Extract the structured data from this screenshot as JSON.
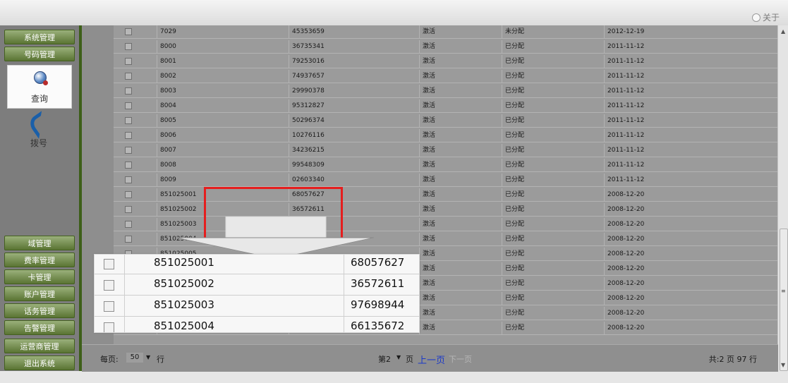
{
  "top": {
    "about_label": "关于"
  },
  "sidebar": {
    "top_items": [
      "系统管理",
      "号码管理"
    ],
    "panels": [
      {
        "label": "查询",
        "icon": "query-icon"
      },
      {
        "label": "拨号",
        "icon": "phone-icon"
      }
    ],
    "bottom_items": [
      "域管理",
      "费率管理",
      "卡管理",
      "账户管理",
      "话务管理",
      "告警管理",
      "运营商管理",
      "退出系统"
    ]
  },
  "grid": {
    "rows": [
      [
        "7029",
        "45353659",
        "激活",
        "未分配",
        "2012-12-19"
      ],
      [
        "8000",
        "36735341",
        "激活",
        "已分配",
        "2011-11-12"
      ],
      [
        "8001",
        "79253016",
        "激活",
        "已分配",
        "2011-11-12"
      ],
      [
        "8002",
        "74937657",
        "激活",
        "已分配",
        "2011-11-12"
      ],
      [
        "8003",
        "29990378",
        "激活",
        "已分配",
        "2011-11-12"
      ],
      [
        "8004",
        "95312827",
        "激活",
        "已分配",
        "2011-11-12"
      ],
      [
        "8005",
        "50296374",
        "激活",
        "已分配",
        "2011-11-12"
      ],
      [
        "8006",
        "10276116",
        "激活",
        "已分配",
        "2011-11-12"
      ],
      [
        "8007",
        "34236215",
        "激活",
        "已分配",
        "2011-11-12"
      ],
      [
        "8008",
        "99548309",
        "激活",
        "已分配",
        "2011-11-12"
      ],
      [
        "8009",
        "02603340",
        "激活",
        "已分配",
        "2011-11-12"
      ],
      [
        "851025001",
        "68057627",
        "激活",
        "已分配",
        "2008-12-20"
      ],
      [
        "851025002",
        "36572611",
        "激活",
        "已分配",
        "2008-12-20"
      ],
      [
        "851025003",
        "",
        "激活",
        "已分配",
        "2008-12-20"
      ],
      [
        "851025004",
        "",
        "激活",
        "已分配",
        "2008-12-20"
      ],
      [
        "851025005",
        "",
        "激活",
        "已分配",
        "2008-12-20"
      ],
      [
        "",
        "",
        "激活",
        "已分配",
        "2008-12-20"
      ],
      [
        "",
        "",
        "激活",
        "已分配",
        "2008-12-20"
      ],
      [
        "",
        "",
        "激活",
        "已分配",
        "2008-12-20"
      ],
      [
        "",
        "",
        "激活",
        "已分配",
        "2008-12-20"
      ],
      [
        "",
        "",
        "激活",
        "已分配",
        "2008-12-20"
      ]
    ]
  },
  "pager": {
    "per_page_label": "每页:",
    "per_page_value": "50",
    "row_unit": "行",
    "page_prefix": "第",
    "page_value": "2",
    "page_unit": "页",
    "prev": "上一页",
    "next": "下一页",
    "total": "共:2 页 97 行"
  },
  "zoom": {
    "rows": [
      [
        "851025001",
        "68057627"
      ],
      [
        "851025002",
        "36572611"
      ],
      [
        "851025003",
        "97698944"
      ],
      [
        "851025004",
        "66135672"
      ]
    ]
  }
}
